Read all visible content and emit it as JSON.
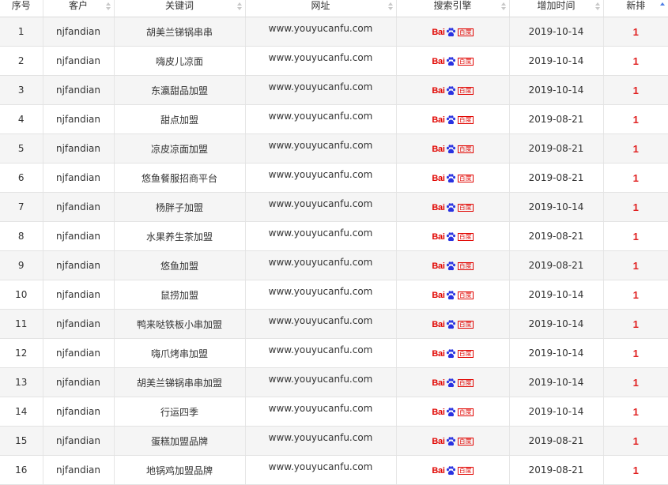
{
  "columns": {
    "index": "序号",
    "client": "客户",
    "keyword": "关键词",
    "url": "网址",
    "engine": "搜索引擎",
    "added": "增加时间",
    "new_rank": "新排"
  },
  "engine_logo": {
    "latin": "Bai",
    "chinese": "百度",
    "icon": "baidu-paw-icon",
    "color": "#e10602"
  },
  "rank_color": "#e02020",
  "rows": [
    {
      "index": "1",
      "client": "njfandian",
      "keyword": "胡美兰锑锅串串",
      "url": "www.youyucanfu.com",
      "added": "2019-10-14",
      "rank": "1"
    },
    {
      "index": "2",
      "client": "njfandian",
      "keyword": "嗨皮儿凉面",
      "url": "www.youyucanfu.com",
      "added": "2019-10-14",
      "rank": "1"
    },
    {
      "index": "3",
      "client": "njfandian",
      "keyword": "东瀛甜品加盟",
      "url": "www.youyucanfu.com",
      "added": "2019-10-14",
      "rank": "1"
    },
    {
      "index": "4",
      "client": "njfandian",
      "keyword": "甜点加盟",
      "url": "www.youyucanfu.com",
      "added": "2019-08-21",
      "rank": "1"
    },
    {
      "index": "5",
      "client": "njfandian",
      "keyword": "凉皮凉面加盟",
      "url": "www.youyucanfu.com",
      "added": "2019-08-21",
      "rank": "1"
    },
    {
      "index": "6",
      "client": "njfandian",
      "keyword": "悠鱼餐服招商平台",
      "url": "www.youyucanfu.com",
      "added": "2019-08-21",
      "rank": "1"
    },
    {
      "index": "7",
      "client": "njfandian",
      "keyword": "杨胖子加盟",
      "url": "www.youyucanfu.com",
      "added": "2019-10-14",
      "rank": "1"
    },
    {
      "index": "8",
      "client": "njfandian",
      "keyword": "水果养生茶加盟",
      "url": "www.youyucanfu.com",
      "added": "2019-08-21",
      "rank": "1"
    },
    {
      "index": "9",
      "client": "njfandian",
      "keyword": "悠鱼加盟",
      "url": "www.youyucanfu.com",
      "added": "2019-08-21",
      "rank": "1"
    },
    {
      "index": "10",
      "client": "njfandian",
      "keyword": "鼠捞加盟",
      "url": "www.youyucanfu.com",
      "added": "2019-10-14",
      "rank": "1"
    },
    {
      "index": "11",
      "client": "njfandian",
      "keyword": "鸭来哒铁板小串加盟",
      "url": "www.youyucanfu.com",
      "added": "2019-10-14",
      "rank": "1"
    },
    {
      "index": "12",
      "client": "njfandian",
      "keyword": "嗨爪烤串加盟",
      "url": "www.youyucanfu.com",
      "added": "2019-10-14",
      "rank": "1"
    },
    {
      "index": "13",
      "client": "njfandian",
      "keyword": "胡美兰锑锅串串加盟",
      "url": "www.youyucanfu.com",
      "added": "2019-10-14",
      "rank": "1"
    },
    {
      "index": "14",
      "client": "njfandian",
      "keyword": "行运四季",
      "url": "www.youyucanfu.com",
      "added": "2019-10-14",
      "rank": "1"
    },
    {
      "index": "15",
      "client": "njfandian",
      "keyword": "蛋糕加盟品牌",
      "url": "www.youyucanfu.com",
      "added": "2019-08-21",
      "rank": "1"
    },
    {
      "index": "16",
      "client": "njfandian",
      "keyword": "地锅鸡加盟品牌",
      "url": "www.youyucanfu.com",
      "added": "2019-08-21",
      "rank": "1"
    }
  ]
}
